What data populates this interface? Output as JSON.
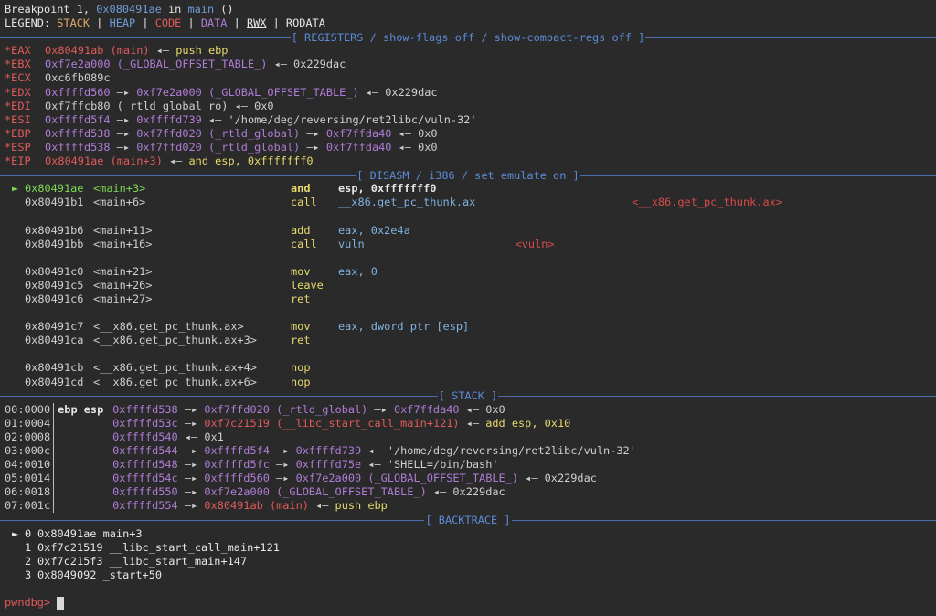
{
  "breakpoint": {
    "prefix": "Breakpoint 1, ",
    "addr": "0x080491ae",
    "mid": " in ",
    "func": "main",
    "suffix": " ()"
  },
  "legend": {
    "label": "LEGEND: ",
    "stack": "STACK",
    "heap": "HEAP",
    "code": "CODE",
    "data": "DATA",
    "rwx": "RWX",
    "rodata": "RODATA",
    "sep": " | "
  },
  "headers": {
    "registers": "[ REGISTERS / show-flags off / show-compact-regs off ]",
    "disasm": "[ DISASM / i386 / set emulate on ]",
    "stack": "[ STACK ]",
    "backtrace": "[ BACKTRACE ]"
  },
  "registers": [
    {
      "name": "*EAX",
      "parts": [
        [
          "red",
          "0x80491ab (main)"
        ],
        [
          "gray",
          " ◂— "
        ],
        [
          "yellow",
          "push ebp"
        ]
      ]
    },
    {
      "name": "*EBX",
      "parts": [
        [
          "purple",
          "0xf7e2a000 (_GLOBAL_OFFSET_TABLE_)"
        ],
        [
          "gray",
          " ◂— 0x229dac"
        ]
      ]
    },
    {
      "name": "*ECX",
      "parts": [
        [
          "gray",
          "0xc6fb089c"
        ]
      ]
    },
    {
      "name": "*EDX",
      "parts": [
        [
          "purple",
          "0xffffd560"
        ],
        [
          "gray",
          " —▸ "
        ],
        [
          "purple",
          "0xf7e2a000 (_GLOBAL_OFFSET_TABLE_)"
        ],
        [
          "gray",
          " ◂— 0x229dac"
        ]
      ]
    },
    {
      "name": "*EDI",
      "parts": [
        [
          "gray",
          "0xf7ffcb80 (_rtld_global_ro) ◂— 0x0"
        ]
      ]
    },
    {
      "name": "*ESI",
      "parts": [
        [
          "purple",
          "0xffffd5f4"
        ],
        [
          "gray",
          " —▸ "
        ],
        [
          "purple",
          "0xffffd739"
        ],
        [
          "gray",
          " ◂— '/home/deg/reversing/ret2libc/vuln-32'"
        ]
      ]
    },
    {
      "name": "*EBP",
      "parts": [
        [
          "purple",
          "0xffffd538"
        ],
        [
          "gray",
          " —▸ "
        ],
        [
          "purple",
          "0xf7ffd020 (_rtld_global)"
        ],
        [
          "gray",
          " —▸ "
        ],
        [
          "purple",
          "0xf7ffda40"
        ],
        [
          "gray",
          " ◂— 0x0"
        ]
      ]
    },
    {
      "name": "*ESP",
      "parts": [
        [
          "purple",
          "0xffffd538"
        ],
        [
          "gray",
          " —▸ "
        ],
        [
          "purple",
          "0xf7ffd020 (_rtld_global)"
        ],
        [
          "gray",
          " —▸ "
        ],
        [
          "purple",
          "0xf7ffda40"
        ],
        [
          "gray",
          " ◂— 0x0"
        ]
      ]
    },
    {
      "name": "*EIP",
      "parts": [
        [
          "red",
          "0x80491ae (main+3)"
        ],
        [
          "gray",
          " ◂— "
        ],
        [
          "yellow",
          "and esp, 0xfffffff0"
        ]
      ]
    }
  ],
  "disasm": [
    {
      "current": true,
      "addr": "0x80491ae",
      "sym": "<main+3>",
      "mn": "and",
      "ops": "esp, 0xfffffff0",
      "target": ""
    },
    {
      "current": false,
      "addr": "0x80491b1",
      "sym": "<main+6>",
      "mn": "call",
      "ops": "__x86.get_pc_thunk.ax",
      "target": "<__x86.get_pc_thunk.ax>",
      "targetCol": 86
    },
    {
      "blank": true
    },
    {
      "current": false,
      "addr": "0x80491b6",
      "sym": "<main+11>",
      "mn": "add",
      "ops": "eax, 0x2e4a",
      "target": ""
    },
    {
      "current": false,
      "addr": "0x80491bb",
      "sym": "<main+16>",
      "mn": "call",
      "ops": "vuln",
      "target": "<vuln>",
      "targetCol": 70
    },
    {
      "blank": true
    },
    {
      "current": false,
      "addr": "0x80491c0",
      "sym": "<main+21>",
      "mn": "mov",
      "ops": "eax, 0",
      "target": ""
    },
    {
      "current": false,
      "addr": "0x80491c5",
      "sym": "<main+26>",
      "mn": "leave",
      "ops": "",
      "target": ""
    },
    {
      "current": false,
      "addr": "0x80491c6",
      "sym": "<main+27>",
      "mn": "ret",
      "ops": "",
      "target": ""
    },
    {
      "blank": true
    },
    {
      "current": false,
      "addr": "0x80491c7",
      "sym": "<__x86.get_pc_thunk.ax>",
      "mn": "mov",
      "ops": "eax, dword ptr [esp]",
      "target": ""
    },
    {
      "current": false,
      "addr": "0x80491ca",
      "sym": "<__x86.get_pc_thunk.ax+3>",
      "mn": "ret",
      "ops": "",
      "target": ""
    },
    {
      "blank": true
    },
    {
      "current": false,
      "addr": "0x80491cb",
      "sym": "<__x86.get_pc_thunk.ax+4>",
      "mn": "nop",
      "ops": "",
      "target": ""
    },
    {
      "current": false,
      "addr": "0x80491cd",
      "sym": "<__x86.get_pc_thunk.ax+6>",
      "mn": "nop",
      "ops": "",
      "target": ""
    }
  ],
  "stack": [
    {
      "idx": "00:0000",
      "regs": "ebp esp",
      "parts": [
        [
          "purple",
          "0xffffd538"
        ],
        [
          "gray",
          " —▸ "
        ],
        [
          "purple",
          "0xf7ffd020 (_rtld_global)"
        ],
        [
          "gray",
          " —▸ "
        ],
        [
          "purple",
          "0xf7ffda40"
        ],
        [
          "gray",
          " ◂— 0x0"
        ]
      ]
    },
    {
      "idx": "01:0004",
      "regs": "",
      "parts": [
        [
          "purple",
          "0xffffd53c"
        ],
        [
          "gray",
          " —▸ "
        ],
        [
          "red",
          "0xf7c21519 (__libc_start_call_main+121)"
        ],
        [
          "gray",
          " ◂— "
        ],
        [
          "yellow",
          "add esp, 0x10"
        ]
      ]
    },
    {
      "idx": "02:0008",
      "regs": "",
      "parts": [
        [
          "purple",
          "0xffffd540"
        ],
        [
          "gray",
          " ◂— 0x1"
        ]
      ]
    },
    {
      "idx": "03:000c",
      "regs": "",
      "parts": [
        [
          "purple",
          "0xffffd544"
        ],
        [
          "gray",
          " —▸ "
        ],
        [
          "purple",
          "0xffffd5f4"
        ],
        [
          "gray",
          " —▸ "
        ],
        [
          "purple",
          "0xffffd739"
        ],
        [
          "gray",
          " ◂— '/home/deg/reversing/ret2libc/vuln-32'"
        ]
      ]
    },
    {
      "idx": "04:0010",
      "regs": "",
      "parts": [
        [
          "purple",
          "0xffffd548"
        ],
        [
          "gray",
          " —▸ "
        ],
        [
          "purple",
          "0xffffd5fc"
        ],
        [
          "gray",
          " —▸ "
        ],
        [
          "purple",
          "0xffffd75e"
        ],
        [
          "gray",
          " ◂— 'SHELL=/bin/bash'"
        ]
      ]
    },
    {
      "idx": "05:0014",
      "regs": "",
      "parts": [
        [
          "purple",
          "0xffffd54c"
        ],
        [
          "gray",
          " —▸ "
        ],
        [
          "purple",
          "0xffffd560"
        ],
        [
          "gray",
          " —▸ "
        ],
        [
          "purple",
          "0xf7e2a000 (_GLOBAL_OFFSET_TABLE_)"
        ],
        [
          "gray",
          " ◂— 0x229dac"
        ]
      ]
    },
    {
      "idx": "06:0018",
      "regs": "",
      "parts": [
        [
          "purple",
          "0xffffd550"
        ],
        [
          "gray",
          " —▸ "
        ],
        [
          "purple",
          "0xf7e2a000 (_GLOBAL_OFFSET_TABLE_)"
        ],
        [
          "gray",
          " ◂— 0x229dac"
        ]
      ]
    },
    {
      "idx": "07:001c",
      "regs": "",
      "parts": [
        [
          "purple",
          "0xffffd554"
        ],
        [
          "gray",
          " —▸ "
        ],
        [
          "red",
          "0x80491ab (main)"
        ],
        [
          "gray",
          " ◂— "
        ],
        [
          "yellow",
          "push ebp"
        ]
      ]
    }
  ],
  "backtrace": [
    {
      "current": true,
      "num": "0",
      "addr": "0x80491ae",
      "sym": "main+3"
    },
    {
      "current": false,
      "num": "1",
      "addr": "0xf7c21519",
      "sym": "__libc_start_call_main+121"
    },
    {
      "current": false,
      "num": "2",
      "addr": "0xf7c215f3",
      "sym": "__libc_start_main+147"
    },
    {
      "current": false,
      "num": "3",
      "addr": "0x8049092",
      "sym": "_start+50"
    }
  ],
  "prompt": {
    "text": "pwndbg>",
    "input": ""
  },
  "colors": {
    "background": "#2a2a2a",
    "header_rule": "#4a6fb3",
    "stack": "#e0a86a",
    "heap": "#6f9cd8",
    "code": "#e05a5a",
    "data": "#b07cd6",
    "register_changed": "#e05a5a",
    "current_arrow": "#7cd655",
    "mnemonic": "#e7d96c",
    "prompt": "#e05a5a"
  },
  "icons": {
    "current_line": "green-triangle-right-icon",
    "backtrace_current": "white-triangle-right-icon"
  }
}
